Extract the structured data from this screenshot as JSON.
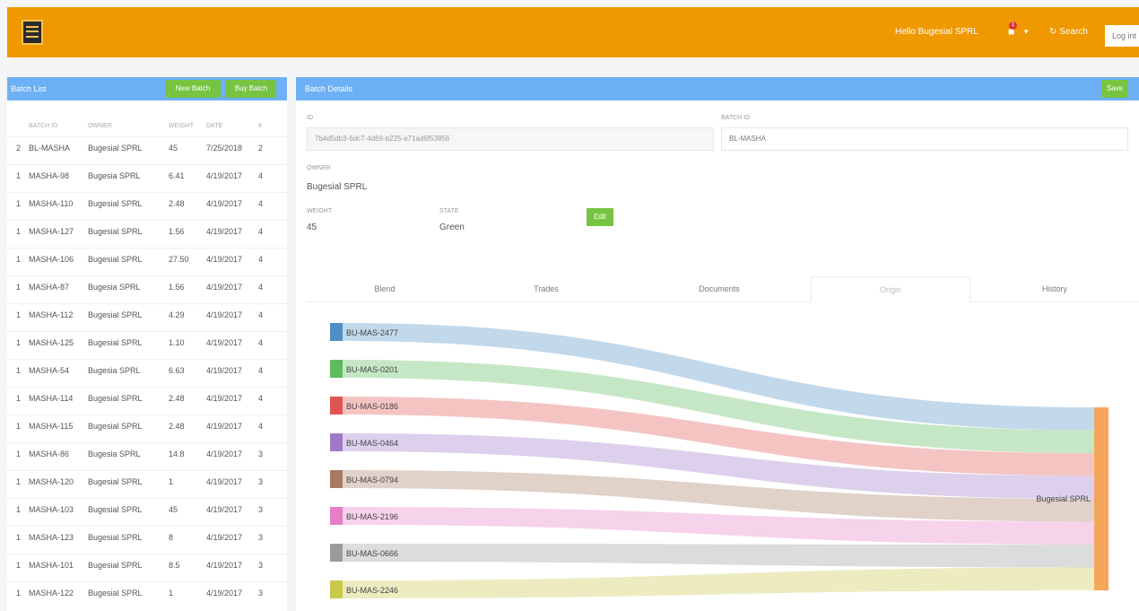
{
  "header": {
    "greeting": "Hello Bugesial SPRL",
    "notification_count": "1",
    "search_label": "Search",
    "login_placeholder": "Log int"
  },
  "left_panel": {
    "title": "Batch List",
    "new_batch_label": "New Batch",
    "buy_batch_label": "Buy Batch",
    "columns": [
      "",
      "BATCH ID",
      "OWNER",
      "WEIGHT",
      "DATE",
      "#"
    ],
    "rows": [
      [
        "2",
        "BL-MASHA",
        "Bugesial SPRL",
        "45",
        "7/25/2018",
        "2"
      ],
      [
        "1",
        "MASHA-98",
        "Bugesia SPRL",
        "6.41",
        "4/19/2017",
        "4"
      ],
      [
        "1",
        "MASHA-110",
        "Bugesial SPRL",
        "2.48",
        "4/19/2017",
        "4"
      ],
      [
        "1",
        "MASHA-127",
        "Bugesial SPRL",
        "1.56",
        "4/19/2017",
        "4"
      ],
      [
        "1",
        "MASHA-106",
        "Bugesial SPRL",
        "27.50",
        "4/19/2017",
        "4"
      ],
      [
        "1",
        "MASHA-87",
        "Bugesia SPRL",
        "1.56",
        "4/19/2017",
        "4"
      ],
      [
        "1",
        "MASHA-112",
        "Bugesial SPRL",
        "4.29",
        "4/19/2017",
        "4"
      ],
      [
        "1",
        "MASHA-125",
        "Bugesial SPRL",
        "1.10",
        "4/19/2017",
        "4"
      ],
      [
        "1",
        "MASHA-54",
        "Bugesia SPRL",
        "6.63",
        "4/19/2017",
        "4"
      ],
      [
        "1",
        "MASHA-114",
        "Bugesial SPRL",
        "2.48",
        "4/19/2017",
        "4"
      ],
      [
        "1",
        "MASHA-115",
        "Bugesial SPRL",
        "2.48",
        "4/19/2017",
        "4"
      ],
      [
        "1",
        "MASHA-86",
        "Bugesia SPRL",
        "14.8",
        "4/19/2017",
        "3"
      ],
      [
        "1",
        "MASHA-120",
        "Bugesial SPRL",
        "1",
        "4/19/2017",
        "3"
      ],
      [
        "1",
        "MASHA-103",
        "Bugesial SPRL",
        "45",
        "4/19/2017",
        "3"
      ],
      [
        "1",
        "MASHA-123",
        "Bugesial SPRL",
        "8",
        "4/19/2017",
        "3"
      ],
      [
        "1",
        "MASHA-101",
        "Bugesial SPRL",
        "8.5",
        "4/19/2017",
        "3"
      ],
      [
        "1",
        "MASHA-122",
        "Bugesial SPRL",
        "1",
        "4/19/2017",
        "3"
      ]
    ]
  },
  "right_panel": {
    "title": "Batch Details",
    "save_label": "Save",
    "id_label": "ID",
    "id_value": "7b4d5db3-6dc7-4d69-b225-e71ad6f53856",
    "batch_id_label": "BATCH ID",
    "batch_id_value": "BL-MASHA",
    "owner_label": "OWNER",
    "owner_value": "Bugesial SPRL",
    "weight_label": "WEIGHT",
    "weight_value": "45",
    "state_label": "STATE",
    "state_value": "Green",
    "edit_label": "Edit",
    "tabs": [
      "Blend",
      "Trades",
      "Documents",
      "Origin",
      "History"
    ],
    "active_tab": "Origin"
  },
  "chart_data": {
    "type": "sankey",
    "sources": [
      {
        "name": "BU-MAS-2477",
        "color": "#4f8fc6"
      },
      {
        "name": "BU-MAS-0201",
        "color": "#5dba5d"
      },
      {
        "name": "BU-MAS-0186",
        "color": "#e05552"
      },
      {
        "name": "BU-MAS-0464",
        "color": "#9d79c8"
      },
      {
        "name": "BU-MAS-0794",
        "color": "#a67a64"
      },
      {
        "name": "BU-MAS-2196",
        "color": "#e77fc6"
      },
      {
        "name": "BU-MAS-0666",
        "color": "#9a9a9a"
      },
      {
        "name": "BU-MAS-2246",
        "color": "#c8c84a"
      }
    ],
    "target": {
      "name": "Bugesial SPRL",
      "color": "#f6a55c"
    }
  }
}
